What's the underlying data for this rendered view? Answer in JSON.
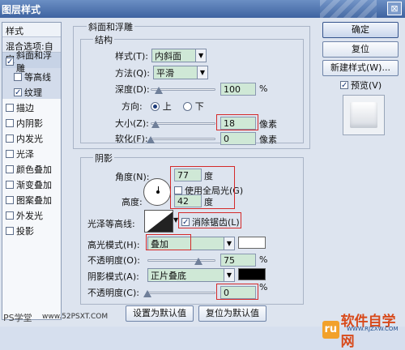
{
  "window": {
    "title": "图层样式",
    "close": "⊠"
  },
  "style_list": {
    "header": "样式",
    "blend_options": "混合选项:自定",
    "items": [
      {
        "label": "斜面和浮雕",
        "checked": true,
        "sub": false,
        "active": true
      },
      {
        "label": "等高线",
        "checked": false,
        "sub": true,
        "active": false
      },
      {
        "label": "纹理",
        "checked": true,
        "sub": true,
        "active": false
      },
      {
        "label": "描边",
        "checked": false,
        "sub": false,
        "active": false
      },
      {
        "label": "内阴影",
        "checked": false,
        "sub": false,
        "active": false
      },
      {
        "label": "内发光",
        "checked": false,
        "sub": false,
        "active": false
      },
      {
        "label": "光泽",
        "checked": false,
        "sub": false,
        "active": false
      },
      {
        "label": "颜色叠加",
        "checked": false,
        "sub": false,
        "active": false
      },
      {
        "label": "渐变叠加",
        "checked": false,
        "sub": false,
        "active": false
      },
      {
        "label": "图案叠加",
        "checked": false,
        "sub": false,
        "active": false
      },
      {
        "label": "外发光",
        "checked": false,
        "sub": false,
        "active": false
      },
      {
        "label": "投影",
        "checked": false,
        "sub": false,
        "active": false
      }
    ]
  },
  "bevel": {
    "group_title": "斜面和浮雕",
    "structure_title": "结构",
    "style_label": "样式(T):",
    "style_value": "内斜面",
    "technique_label": "方法(Q):",
    "technique_value": "平滑",
    "depth_label": "深度(D):",
    "depth_value": "100",
    "depth_unit": "%",
    "depth_slider_fraction": 0.12,
    "direction_label": "方向:",
    "direction_up": "上",
    "direction_down": "下",
    "direction_selected": "up",
    "size_label": "大小(Z):",
    "size_value": "18",
    "size_unit": "像素",
    "size_slider_fraction": 0.07,
    "soften_label": "软化(F):",
    "soften_value": "0",
    "soften_unit": "像素",
    "soften_slider_fraction": 0.0
  },
  "shading": {
    "title": "阴影",
    "angle_label": "角度(N):",
    "angle_value": "77",
    "angle_unit": "度",
    "global_light_label": "使用全局光(G)",
    "global_light_checked": false,
    "altitude_label": "高度:",
    "altitude_value": "42",
    "altitude_unit": "度",
    "gloss_contour_label": "光泽等高线:",
    "anti_alias_label": "消除锯齿(L)",
    "anti_alias_checked": true,
    "highlight_mode_label": "高光模式(H):",
    "highlight_mode_value": "叠加",
    "highlight_color": "#ffffff",
    "highlight_opacity_label": "不透明度(O):",
    "highlight_opacity_value": "75",
    "highlight_opacity_fraction": 0.75,
    "highlight_opacity_unit": "%",
    "shadow_mode_label": "阴影模式(A):",
    "shadow_mode_value": "正片叠底",
    "shadow_color": "#000000",
    "shadow_opacity_label": "不透明度(C):",
    "shadow_opacity_value": "0",
    "shadow_opacity_fraction": 0.0,
    "shadow_opacity_unit": "%"
  },
  "footer": {
    "set_default": "设置为默认值",
    "reset_default": "复位为默认值"
  },
  "buttons": {
    "ok": "确定",
    "reset": "复位",
    "new_style": "新建样式(W)...",
    "preview_label": "预览(V)",
    "preview_checked": true
  },
  "watermarks": {
    "left": "PS学堂",
    "site": "www.52PSXT.COM",
    "logo": "软件自学网",
    "logo_sub": "WWW.RJZXW.COM"
  }
}
